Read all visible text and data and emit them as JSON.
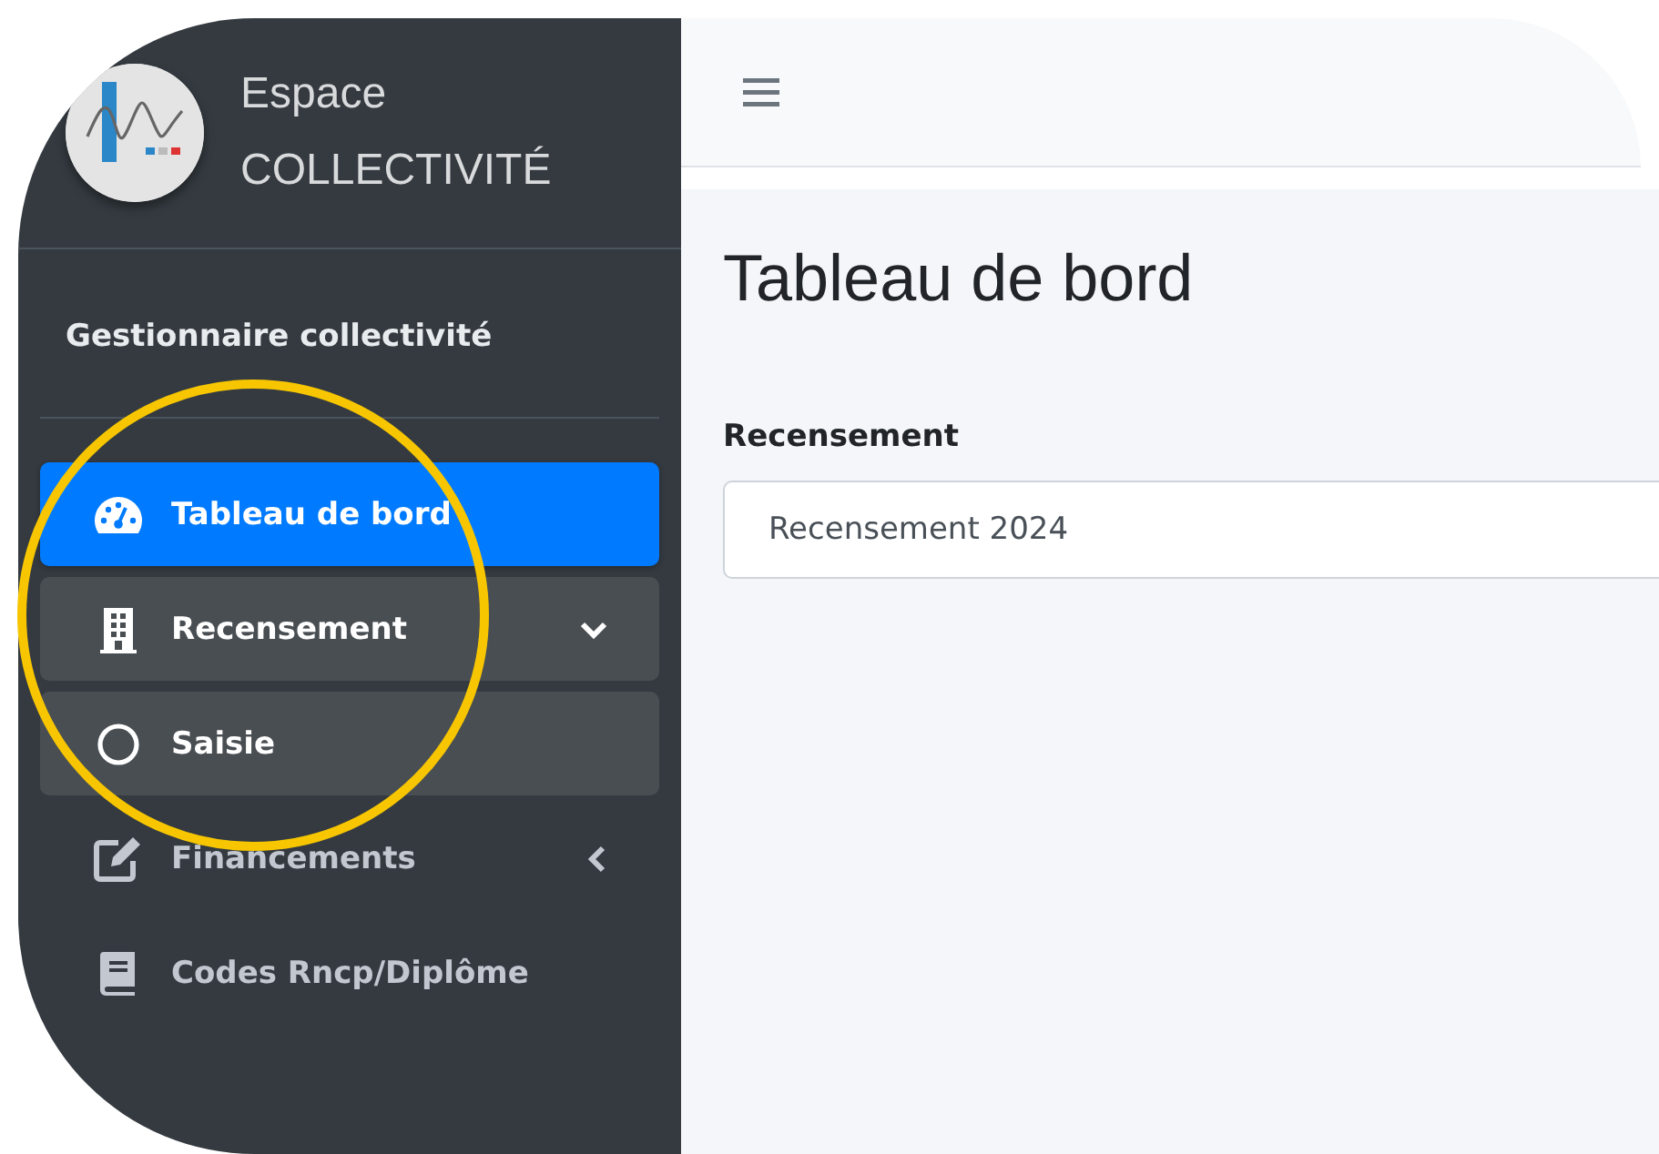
{
  "brand": {
    "line1": "Espace",
    "line2": "COLLECTIVITÉ"
  },
  "user": {
    "name": "Gestionnaire collectivité"
  },
  "nav": [
    {
      "label": "Tableau de bord",
      "selected": true
    },
    {
      "label": "Recensement",
      "selected": false,
      "expanded": true,
      "children": [
        {
          "label": "Saisie",
          "selected": false
        }
      ]
    },
    {
      "label": "Financements",
      "selected": false,
      "expanded": false
    },
    {
      "label": "Codes Rncp/Diplôme",
      "selected": false
    }
  ],
  "page": {
    "title": "Tableau de bord",
    "field_label": "Recensement",
    "field_value": "Recensement 2024"
  }
}
